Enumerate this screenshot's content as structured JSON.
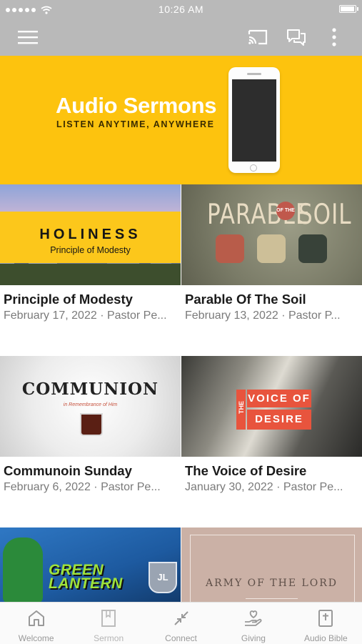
{
  "status_bar": {
    "time": "10:26 AM",
    "battery_level": 0.95
  },
  "app_bar": {
    "menu_icon": "hamburger-menu-icon",
    "actions": [
      {
        "icon": "cast-icon"
      },
      {
        "icon": "chat-icon"
      },
      {
        "icon": "more-vert-icon"
      }
    ]
  },
  "banner": {
    "title": "Audio Sermons",
    "subtitle": "LISTEN ANYTIME, ANYWHERE",
    "background": "#fdc30e"
  },
  "sermons": [
    {
      "title": "Principle of Modesty",
      "meta": "February 17, 2022 · Pastor Pe...",
      "art": {
        "line1": "HOLINESS",
        "line2": "Principle of Modesty"
      }
    },
    {
      "title": "Parable Of The Soil",
      "meta": "February 13, 2022 · Pastor P...",
      "art": {
        "word1": "PARABLE",
        "of": "OF THE",
        "word2": "SOIL"
      }
    },
    {
      "title": "Communoin Sunday",
      "meta": "February 6, 2022 · Pastor Pe...",
      "art": {
        "word": "COMMUNION",
        "sub": "in Remembrance of Him"
      }
    },
    {
      "title": "The Voice of Desire",
      "meta": "January 30, 2022 · Pastor Pe...",
      "art": {
        "the": "THE",
        "line1": "VOICE OF",
        "line2": "DESIRE"
      }
    },
    {
      "title": "",
      "meta": "",
      "art": {
        "word": "GREEN LANTERN",
        "badge": "JL"
      }
    },
    {
      "title": "",
      "meta": "",
      "art": {
        "word": "ARMY OF THE LORD"
      }
    }
  ],
  "tabs": [
    {
      "label": "Welcome",
      "icon": "home-icon",
      "dimmed": false
    },
    {
      "label": "Sermon",
      "icon": "bookmark-icon",
      "dimmed": true
    },
    {
      "label": "Connect",
      "icon": "connect-arrows-icon",
      "dimmed": false
    },
    {
      "label": "Giving",
      "icon": "giving-hand-icon",
      "dimmed": false
    },
    {
      "label": "Audio Bible",
      "icon": "bible-icon",
      "dimmed": false
    }
  ]
}
